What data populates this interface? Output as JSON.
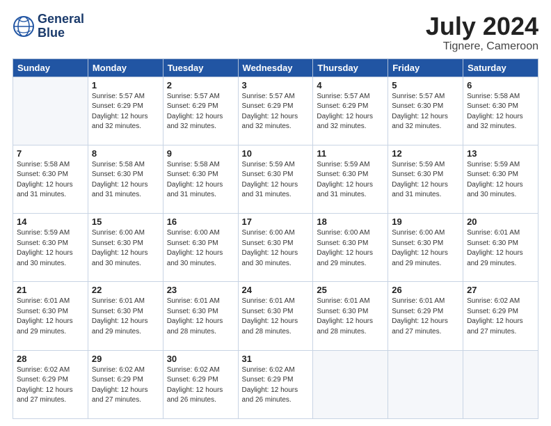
{
  "header": {
    "logo_line1": "General",
    "logo_line2": "Blue",
    "main_title": "July 2024",
    "sub_title": "Tignere, Cameroon"
  },
  "columns": [
    "Sunday",
    "Monday",
    "Tuesday",
    "Wednesday",
    "Thursday",
    "Friday",
    "Saturday"
  ],
  "weeks": [
    [
      {
        "day": "",
        "text": ""
      },
      {
        "day": "1",
        "text": "Sunrise: 5:57 AM\nSunset: 6:29 PM\nDaylight: 12 hours\nand 32 minutes."
      },
      {
        "day": "2",
        "text": "Sunrise: 5:57 AM\nSunset: 6:29 PM\nDaylight: 12 hours\nand 32 minutes."
      },
      {
        "day": "3",
        "text": "Sunrise: 5:57 AM\nSunset: 6:29 PM\nDaylight: 12 hours\nand 32 minutes."
      },
      {
        "day": "4",
        "text": "Sunrise: 5:57 AM\nSunset: 6:29 PM\nDaylight: 12 hours\nand 32 minutes."
      },
      {
        "day": "5",
        "text": "Sunrise: 5:57 AM\nSunset: 6:30 PM\nDaylight: 12 hours\nand 32 minutes."
      },
      {
        "day": "6",
        "text": "Sunrise: 5:58 AM\nSunset: 6:30 PM\nDaylight: 12 hours\nand 32 minutes."
      }
    ],
    [
      {
        "day": "7",
        "text": "Sunrise: 5:58 AM\nSunset: 6:30 PM\nDaylight: 12 hours\nand 31 minutes."
      },
      {
        "day": "8",
        "text": "Sunrise: 5:58 AM\nSunset: 6:30 PM\nDaylight: 12 hours\nand 31 minutes."
      },
      {
        "day": "9",
        "text": "Sunrise: 5:58 AM\nSunset: 6:30 PM\nDaylight: 12 hours\nand 31 minutes."
      },
      {
        "day": "10",
        "text": "Sunrise: 5:59 AM\nSunset: 6:30 PM\nDaylight: 12 hours\nand 31 minutes."
      },
      {
        "day": "11",
        "text": "Sunrise: 5:59 AM\nSunset: 6:30 PM\nDaylight: 12 hours\nand 31 minutes."
      },
      {
        "day": "12",
        "text": "Sunrise: 5:59 AM\nSunset: 6:30 PM\nDaylight: 12 hours\nand 31 minutes."
      },
      {
        "day": "13",
        "text": "Sunrise: 5:59 AM\nSunset: 6:30 PM\nDaylight: 12 hours\nand 30 minutes."
      }
    ],
    [
      {
        "day": "14",
        "text": "Sunrise: 5:59 AM\nSunset: 6:30 PM\nDaylight: 12 hours\nand 30 minutes."
      },
      {
        "day": "15",
        "text": "Sunrise: 6:00 AM\nSunset: 6:30 PM\nDaylight: 12 hours\nand 30 minutes."
      },
      {
        "day": "16",
        "text": "Sunrise: 6:00 AM\nSunset: 6:30 PM\nDaylight: 12 hours\nand 30 minutes."
      },
      {
        "day": "17",
        "text": "Sunrise: 6:00 AM\nSunset: 6:30 PM\nDaylight: 12 hours\nand 30 minutes."
      },
      {
        "day": "18",
        "text": "Sunrise: 6:00 AM\nSunset: 6:30 PM\nDaylight: 12 hours\nand 29 minutes."
      },
      {
        "day": "19",
        "text": "Sunrise: 6:00 AM\nSunset: 6:30 PM\nDaylight: 12 hours\nand 29 minutes."
      },
      {
        "day": "20",
        "text": "Sunrise: 6:01 AM\nSunset: 6:30 PM\nDaylight: 12 hours\nand 29 minutes."
      }
    ],
    [
      {
        "day": "21",
        "text": "Sunrise: 6:01 AM\nSunset: 6:30 PM\nDaylight: 12 hours\nand 29 minutes."
      },
      {
        "day": "22",
        "text": "Sunrise: 6:01 AM\nSunset: 6:30 PM\nDaylight: 12 hours\nand 29 minutes."
      },
      {
        "day": "23",
        "text": "Sunrise: 6:01 AM\nSunset: 6:30 PM\nDaylight: 12 hours\nand 28 minutes."
      },
      {
        "day": "24",
        "text": "Sunrise: 6:01 AM\nSunset: 6:30 PM\nDaylight: 12 hours\nand 28 minutes."
      },
      {
        "day": "25",
        "text": "Sunrise: 6:01 AM\nSunset: 6:30 PM\nDaylight: 12 hours\nand 28 minutes."
      },
      {
        "day": "26",
        "text": "Sunrise: 6:01 AM\nSunset: 6:29 PM\nDaylight: 12 hours\nand 27 minutes."
      },
      {
        "day": "27",
        "text": "Sunrise: 6:02 AM\nSunset: 6:29 PM\nDaylight: 12 hours\nand 27 minutes."
      }
    ],
    [
      {
        "day": "28",
        "text": "Sunrise: 6:02 AM\nSunset: 6:29 PM\nDaylight: 12 hours\nand 27 minutes."
      },
      {
        "day": "29",
        "text": "Sunrise: 6:02 AM\nSunset: 6:29 PM\nDaylight: 12 hours\nand 27 minutes."
      },
      {
        "day": "30",
        "text": "Sunrise: 6:02 AM\nSunset: 6:29 PM\nDaylight: 12 hours\nand 26 minutes."
      },
      {
        "day": "31",
        "text": "Sunrise: 6:02 AM\nSunset: 6:29 PM\nDaylight: 12 hours\nand 26 minutes."
      },
      {
        "day": "",
        "text": ""
      },
      {
        "day": "",
        "text": ""
      },
      {
        "day": "",
        "text": ""
      }
    ]
  ]
}
